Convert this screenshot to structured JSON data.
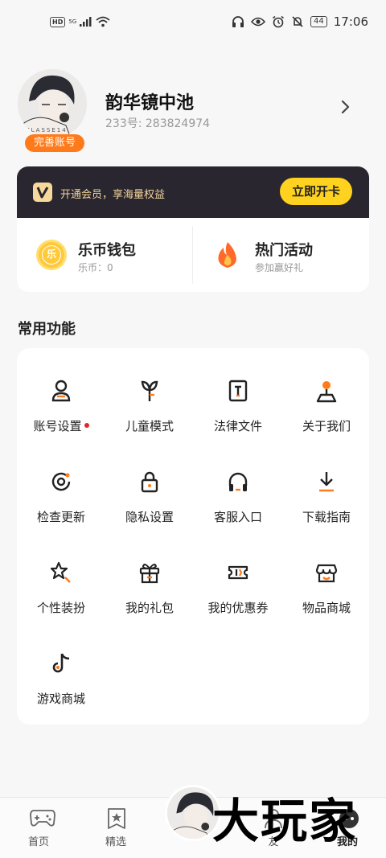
{
  "status_bar": {
    "left_indicators": [
      "HD",
      "5G"
    ],
    "time": "17:06",
    "battery": "44"
  },
  "profile": {
    "username": "韵华镜中池",
    "user_id": "233号: 283824974",
    "complete_badge": "完善账号"
  },
  "vip": {
    "promo_text": "开通会员，享海量权益",
    "open_button": "立即开卡"
  },
  "wallet": {
    "title": "乐币钱包",
    "balance_label": "乐币：0",
    "coin_glyph": "乐"
  },
  "activity": {
    "title": "热门活动",
    "subtitle": "参加赢好礼"
  },
  "common_functions": {
    "title": "常用功能",
    "items": [
      {
        "label": "账号设置",
        "icon": "account-icon",
        "has_dot": true
      },
      {
        "label": "儿童模式",
        "icon": "sprout-icon"
      },
      {
        "label": "法律文件",
        "icon": "legal-document-icon"
      },
      {
        "label": "关于我们",
        "icon": "about-pin-icon"
      },
      {
        "label": "检查更新",
        "icon": "refresh-update-icon"
      },
      {
        "label": "隐私设置",
        "icon": "lock-icon"
      },
      {
        "label": "客服入口",
        "icon": "headphones-icon"
      },
      {
        "label": "下载指南",
        "icon": "download-icon"
      },
      {
        "label": "个性装扮",
        "icon": "star-wand-icon"
      },
      {
        "label": "我的礼包",
        "icon": "gift-icon"
      },
      {
        "label": "我的优惠券",
        "icon": "ticket-icon"
      },
      {
        "label": "物品商城",
        "icon": "shop-icon"
      },
      {
        "label": "游戏商城",
        "icon": "music-note-icon"
      }
    ]
  },
  "bottom_nav": {
    "items": [
      {
        "label": "首页",
        "icon": "gamepad-icon"
      },
      {
        "label": "精选",
        "icon": "star-badge-icon"
      },
      {
        "label": "友",
        "icon": "friends-icon"
      },
      {
        "label": "我的",
        "icon": "profile-icon"
      }
    ]
  },
  "watermark": "大玩家",
  "colors": {
    "accent_orange": "#ff7a1a",
    "vip_bg": "#2a2630",
    "vip_button": "#ffd21f",
    "red_dot": "#e6242a"
  }
}
